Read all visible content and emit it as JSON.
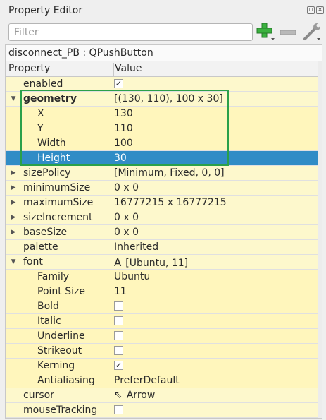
{
  "window": {
    "title": "Property Editor"
  },
  "toolbar": {
    "filter_placeholder": "Filter",
    "filter_value": ""
  },
  "class_label": "disconnect_PB : QPushButton",
  "header": {
    "property": "Property",
    "value": "Value"
  },
  "rows": [
    {
      "name": "enabled",
      "value": "",
      "check": "✓"
    },
    {
      "name": "geometry",
      "value": "[(130, 110), 100 x 30]"
    },
    {
      "name": "X",
      "value": "130"
    },
    {
      "name": "Y",
      "value": "110"
    },
    {
      "name": "Width",
      "value": "100"
    },
    {
      "name": "Height",
      "value": "30"
    },
    {
      "name": "sizePolicy",
      "value": "[Minimum, Fixed, 0, 0]"
    },
    {
      "name": "minimumSize",
      "value": "0 x 0"
    },
    {
      "name": "maximumSize",
      "value": "16777215 x 16777215"
    },
    {
      "name": "sizeIncrement",
      "value": "0 x 0"
    },
    {
      "name": "baseSize",
      "value": "0 x 0"
    },
    {
      "name": "palette",
      "value": "Inherited"
    },
    {
      "name": "font",
      "value": "[Ubuntu, 11]",
      "icon": "A"
    },
    {
      "name": "Family",
      "value": "Ubuntu"
    },
    {
      "name": "Point Size",
      "value": "11"
    },
    {
      "name": "Bold",
      "value": "",
      "check": ""
    },
    {
      "name": "Italic",
      "value": "",
      "check": ""
    },
    {
      "name": "Underline",
      "value": "",
      "check": ""
    },
    {
      "name": "Strikeout",
      "value": "",
      "check": ""
    },
    {
      "name": "Kerning",
      "value": "",
      "check": "✓"
    },
    {
      "name": "Antialiasing",
      "value": "PreferDefault"
    },
    {
      "name": "cursor",
      "value": "Arrow",
      "icon": "⇖"
    },
    {
      "name": "mouseTracking",
      "value": "",
      "check": ""
    }
  ],
  "colors": {
    "selection": "#308cc6",
    "highlight_box": "#2aa04a"
  }
}
